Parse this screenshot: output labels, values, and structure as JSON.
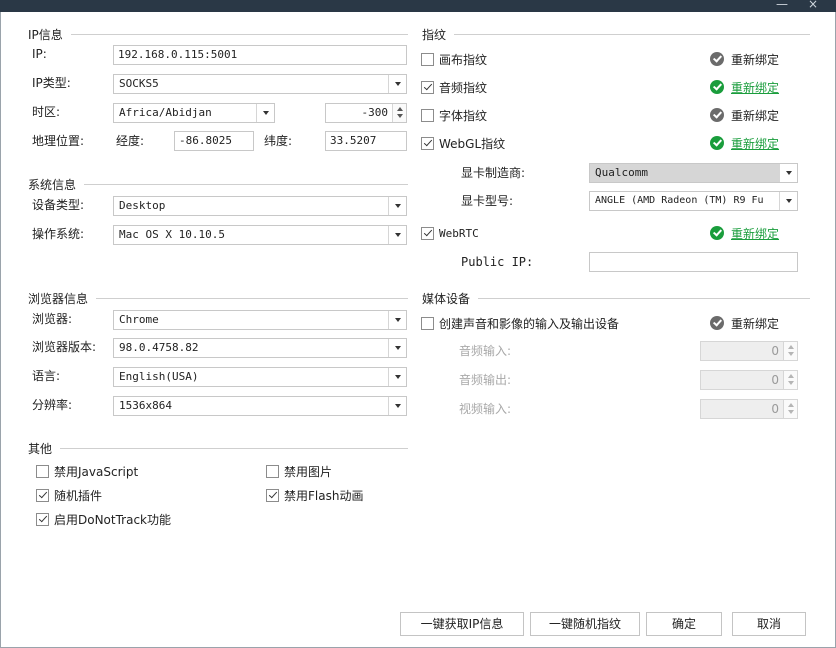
{
  "colors": {
    "titlebar": "#2a3846",
    "success": "#1a9d3c",
    "neutral_icon": "#6b6b6b"
  },
  "window": {
    "minimize": "—",
    "close": "×"
  },
  "ip_section": {
    "title": "IP信息",
    "ip_label": "IP:",
    "ip_value": "192.168.0.115:5001",
    "type_label": "IP类型:",
    "type_value": "SOCKS5",
    "tz_label": "时区:",
    "tz_value": "Africa/Abidjan",
    "tz_offset": "-300",
    "geo_label": "地理位置:",
    "lon_label": "经度:",
    "lon_value": "-86.8025",
    "lat_label": "纬度:",
    "lat_value": "33.5207"
  },
  "system_section": {
    "title": "系统信息",
    "device_label": "设备类型:",
    "device_value": "Desktop",
    "os_label": "操作系统:",
    "os_value": "Mac OS X 10.10.5"
  },
  "browser_section": {
    "title": "浏览器信息",
    "browser_label": "浏览器:",
    "browser_value": "Chrome",
    "version_label": "浏览器版本:",
    "version_value": "98.0.4758.82",
    "lang_label": "语言:",
    "lang_value": "English(USA)",
    "res_label": "分辨率:",
    "res_value": "1536x864"
  },
  "other_section": {
    "title": "其他",
    "disable_js": "禁用JavaScript",
    "disable_images": "禁用图片",
    "random_plugins": "随机插件",
    "disable_flash": "禁用Flash动画",
    "dnt": "启用DoNotTrack功能"
  },
  "fingerprint_section": {
    "title": "指纹",
    "canvas": "画布指纹",
    "audio": "音频指纹",
    "font": "字体指纹",
    "webgl": "WebGL指纹",
    "vendor_label": "显卡制造商:",
    "vendor_value": "Qualcomm",
    "model_label": "显卡型号:",
    "model_value": "ANGLE (AMD Radeon (TM) R9 Fu",
    "webrtc": "WebRTC",
    "public_ip_label": "Public IP:",
    "public_ip_value": "",
    "rebind": "重新绑定"
  },
  "media_section": {
    "title": "媒体设备",
    "create_devices": "创建声音和影像的输入及输出设备",
    "audio_in_label": "音频输入:",
    "audio_in_value": "0",
    "audio_out_label": "音频输出:",
    "audio_out_value": "0",
    "video_in_label": "视频输入:",
    "video_in_value": "0"
  },
  "buttons": {
    "get_ip": "一键获取IP信息",
    "random_fp": "一键随机指纹",
    "ok": "确定",
    "cancel": "取消"
  }
}
